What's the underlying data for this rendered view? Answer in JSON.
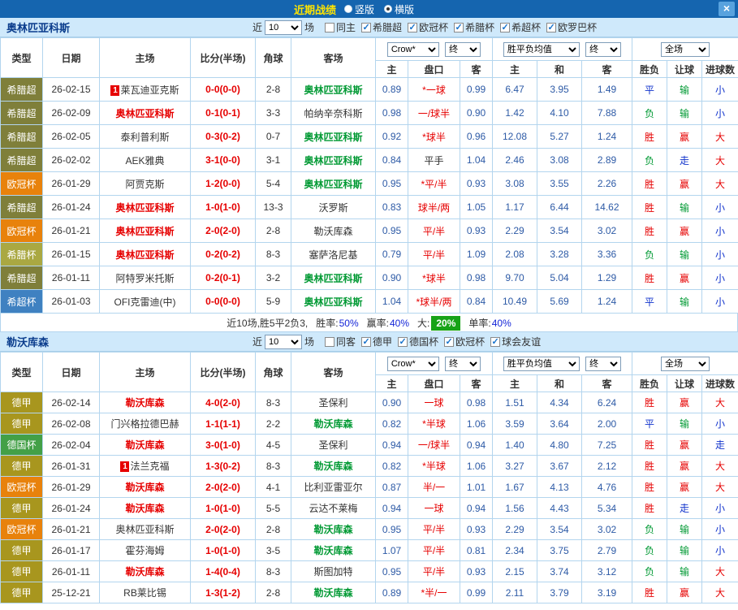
{
  "topbar": {
    "title": "近期战绩",
    "radios": [
      {
        "label": "竖版",
        "selected": false
      },
      {
        "label": "横版",
        "selected": true
      }
    ],
    "close_label": "×"
  },
  "table_header": {
    "cols": [
      "类型",
      "日期",
      "主场",
      "比分(半场)",
      "角球",
      "客场"
    ],
    "sub_cols": [
      "主",
      "盘口",
      "客",
      "主",
      "和",
      "客",
      "胜负",
      "让球",
      "进球数"
    ],
    "odds_source_select": "Crow*",
    "final_label": "终",
    "europe_select": "胜平负均值",
    "scope_select": "全场"
  },
  "sections": [
    {
      "team": "奥林匹亚科斯",
      "near_label": "近",
      "count_value": "10",
      "games_label": "场",
      "checkboxes": [
        {
          "label": "同主",
          "checked": false
        },
        {
          "label": "希腊超",
          "checked": true
        },
        {
          "label": "欧冠杯",
          "checked": true
        },
        {
          "label": "希腊杯",
          "checked": true
        },
        {
          "label": "希超杯",
          "checked": true
        },
        {
          "label": "欧罗巴杯",
          "checked": true
        }
      ],
      "rows": [
        {
          "type": "希腊超",
          "type_color": "#7f7f3a",
          "date": "26-02-15",
          "home": "莱瓦迪亚克斯",
          "home_badge": "1",
          "home_color": "dark",
          "score": "0-0(0-0)",
          "corners": "2-8",
          "away": "奥林匹亚科斯",
          "away_color": "green",
          "asia_home": "0.89",
          "handicap": "*一球",
          "handicap_color": "red",
          "asia_away": "0.99",
          "euro_home": "6.47",
          "euro_draw": "3.95",
          "euro_away": "1.49",
          "result": "平",
          "result_color": "blue",
          "cover": "输",
          "cover_color": "green",
          "goals": "小",
          "goals_color": "blue"
        },
        {
          "type": "希腊超",
          "type_color": "#7f7f3a",
          "date": "26-02-09",
          "home": "奥林匹亚科斯",
          "home_color": "red",
          "score": "0-1(0-1)",
          "corners": "3-3",
          "away": "帕纳辛奈科斯",
          "away_color": "dark",
          "asia_home": "0.98",
          "handicap": "一/球半",
          "handicap_color": "red",
          "asia_away": "0.90",
          "euro_home": "1.42",
          "euro_draw": "4.10",
          "euro_away": "7.88",
          "result": "负",
          "result_color": "green",
          "cover": "输",
          "cover_color": "green",
          "goals": "小",
          "goals_color": "blue"
        },
        {
          "type": "希腊超",
          "type_color": "#7f7f3a",
          "date": "26-02-05",
          "home": "泰利普利斯",
          "home_color": "dark",
          "score": "0-3(0-2)",
          "corners": "0-7",
          "away": "奥林匹亚科斯",
          "away_color": "green",
          "asia_home": "0.92",
          "handicap": "*球半",
          "handicap_color": "red",
          "asia_away": "0.96",
          "euro_home": "12.08",
          "euro_draw": "5.27",
          "euro_away": "1.24",
          "result": "胜",
          "result_color": "red",
          "cover": "赢",
          "cover_color": "red",
          "goals": "大",
          "goals_color": "red"
        },
        {
          "type": "希腊超",
          "type_color": "#7f7f3a",
          "date": "26-02-02",
          "home": "AEK雅典",
          "home_color": "dark",
          "score": "3-1(0-0)",
          "corners": "3-1",
          "away": "奥林匹亚科斯",
          "away_color": "green",
          "asia_home": "0.84",
          "handicap": "平手",
          "handicap_color": "dark",
          "asia_away": "1.04",
          "euro_home": "2.46",
          "euro_draw": "3.08",
          "euro_away": "2.89",
          "result": "负",
          "result_color": "green",
          "cover": "走",
          "cover_color": "blue",
          "goals": "大",
          "goals_color": "red"
        },
        {
          "type": "欧冠杯",
          "type_color": "#e8820c",
          "date": "26-01-29",
          "home": "阿贾克斯",
          "home_color": "dark",
          "score": "1-2(0-0)",
          "corners": "5-4",
          "away": "奥林匹亚科斯",
          "away_color": "green",
          "asia_home": "0.95",
          "handicap": "*平/半",
          "handicap_color": "red",
          "asia_away": "0.93",
          "euro_home": "3.08",
          "euro_draw": "3.55",
          "euro_away": "2.26",
          "result": "胜",
          "result_color": "red",
          "cover": "赢",
          "cover_color": "red",
          "goals": "大",
          "goals_color": "red"
        },
        {
          "type": "希腊超",
          "type_color": "#7f7f3a",
          "date": "26-01-24",
          "home": "奥林匹亚科斯",
          "home_color": "red",
          "score": "1-0(1-0)",
          "corners": "13-3",
          "away": "沃罗斯",
          "away_color": "dark",
          "asia_home": "0.83",
          "handicap": "球半/两",
          "handicap_color": "red",
          "asia_away": "1.05",
          "euro_home": "1.17",
          "euro_draw": "6.44",
          "euro_away": "14.62",
          "result": "胜",
          "result_color": "red",
          "cover": "输",
          "cover_color": "green",
          "goals": "小",
          "goals_color": "blue"
        },
        {
          "type": "欧冠杯",
          "type_color": "#e8820c",
          "date": "26-01-21",
          "home": "奥林匹亚科斯",
          "home_color": "red",
          "score": "2-0(2-0)",
          "corners": "2-8",
          "away": "勒沃库森",
          "away_color": "dark",
          "asia_home": "0.95",
          "handicap": "平/半",
          "handicap_color": "red",
          "asia_away": "0.93",
          "euro_home": "2.29",
          "euro_draw": "3.54",
          "euro_away": "3.02",
          "result": "胜",
          "result_color": "red",
          "cover": "赢",
          "cover_color": "red",
          "goals": "小",
          "goals_color": "blue"
        },
        {
          "type": "希腊杯",
          "type_color": "#aaa842",
          "date": "26-01-15",
          "home": "奥林匹亚科斯",
          "home_color": "red",
          "score": "0-2(0-2)",
          "corners": "8-3",
          "away": "塞萨洛尼基",
          "away_color": "dark",
          "asia_home": "0.79",
          "handicap": "平/半",
          "handicap_color": "red",
          "asia_away": "1.09",
          "euro_home": "2.08",
          "euro_draw": "3.28",
          "euro_away": "3.36",
          "result": "负",
          "result_color": "green",
          "cover": "输",
          "cover_color": "green",
          "goals": "小",
          "goals_color": "blue"
        },
        {
          "type": "希腊超",
          "type_color": "#7f7f3a",
          "date": "26-01-11",
          "home": "阿特罗米托斯",
          "home_color": "dark",
          "score": "0-2(0-1)",
          "corners": "3-2",
          "away": "奥林匹亚科斯",
          "away_color": "green",
          "asia_home": "0.90",
          "handicap": "*球半",
          "handicap_color": "red",
          "asia_away": "0.98",
          "euro_home": "9.70",
          "euro_draw": "5.04",
          "euro_away": "1.29",
          "result": "胜",
          "result_color": "red",
          "cover": "赢",
          "cover_color": "red",
          "goals": "小",
          "goals_color": "blue"
        },
        {
          "type": "希超杯",
          "type_color": "#3f81c1",
          "date": "26-01-03",
          "home": "OFI克雷迪(中)",
          "home_color": "dark",
          "score": "0-0(0-0)",
          "corners": "5-9",
          "away": "奥林匹亚科斯",
          "away_color": "green",
          "asia_home": "1.04",
          "handicap": "*球半/两",
          "handicap_color": "red",
          "asia_away": "0.84",
          "euro_home": "10.49",
          "euro_draw": "5.69",
          "euro_away": "1.24",
          "result": "平",
          "result_color": "blue",
          "cover": "输",
          "cover_color": "green",
          "goals": "小",
          "goals_color": "blue"
        }
      ],
      "summary": {
        "record": "近10场,胜5平2负3,",
        "win_label": "胜率:",
        "win_value": "50%",
        "cover_label": "赢率:",
        "cover_value": "40%",
        "big_label": "大:",
        "big_value": "20%",
        "odd_label": "单率:",
        "odd_value": "40%"
      }
    },
    {
      "team": "勒沃库森",
      "near_label": "近",
      "count_value": "10",
      "games_label": "场",
      "checkboxes": [
        {
          "label": "同客",
          "checked": false
        },
        {
          "label": "德甲",
          "checked": true
        },
        {
          "label": "德国杯",
          "checked": true
        },
        {
          "label": "欧冠杯",
          "checked": true
        },
        {
          "label": "球会友谊",
          "checked": true
        }
      ],
      "rows": [
        {
          "type": "德甲",
          "type_color": "#a8961e",
          "date": "26-02-14",
          "home": "勒沃库森",
          "home_color": "red",
          "score": "4-0(2-0)",
          "corners": "8-3",
          "away": "圣保利",
          "away_color": "dark",
          "asia_home": "0.90",
          "handicap": "一球",
          "handicap_color": "red",
          "asia_away": "0.98",
          "euro_home": "1.51",
          "euro_draw": "4.34",
          "euro_away": "6.24",
          "result": "胜",
          "result_color": "red",
          "cover": "赢",
          "cover_color": "red",
          "goals": "大",
          "goals_color": "red"
        },
        {
          "type": "德甲",
          "type_color": "#a8961e",
          "date": "26-02-08",
          "home": "门兴格拉德巴赫",
          "home_color": "dark",
          "score": "1-1(1-1)",
          "corners": "2-2",
          "away": "勒沃库森",
          "away_color": "green",
          "asia_home": "0.82",
          "handicap": "*半球",
          "handicap_color": "red",
          "asia_away": "1.06",
          "euro_home": "3.59",
          "euro_draw": "3.64",
          "euro_away": "2.00",
          "result": "平",
          "result_color": "blue",
          "cover": "输",
          "cover_color": "green",
          "goals": "小",
          "goals_color": "blue"
        },
        {
          "type": "德国杯",
          "type_color": "#43a047",
          "date": "26-02-04",
          "home": "勒沃库森",
          "home_color": "red",
          "score": "3-0(1-0)",
          "corners": "4-5",
          "away": "圣保利",
          "away_color": "dark",
          "asia_home": "0.94",
          "handicap": "一/球半",
          "handicap_color": "red",
          "asia_away": "0.94",
          "euro_home": "1.40",
          "euro_draw": "4.80",
          "euro_away": "7.25",
          "result": "胜",
          "result_color": "red",
          "cover": "赢",
          "cover_color": "red",
          "goals": "走",
          "goals_color": "blue"
        },
        {
          "type": "德甲",
          "type_color": "#a8961e",
          "date": "26-01-31",
          "home": "法兰克福",
          "home_badge": "1",
          "home_color": "dark",
          "score": "1-3(0-2)",
          "corners": "8-3",
          "away": "勒沃库森",
          "away_color": "green",
          "asia_home": "0.82",
          "handicap": "*半球",
          "handicap_color": "red",
          "asia_away": "1.06",
          "euro_home": "3.27",
          "euro_draw": "3.67",
          "euro_away": "2.12",
          "result": "胜",
          "result_color": "red",
          "cover": "赢",
          "cover_color": "red",
          "goals": "大",
          "goals_color": "red"
        },
        {
          "type": "欧冠杯",
          "type_color": "#e8820c",
          "date": "26-01-29",
          "home": "勒沃库森",
          "home_color": "red",
          "score": "2-0(2-0)",
          "corners": "4-1",
          "away": "比利亚雷亚尔",
          "away_color": "dark",
          "asia_home": "0.87",
          "handicap": "半/一",
          "handicap_color": "red",
          "asia_away": "1.01",
          "euro_home": "1.67",
          "euro_draw": "4.13",
          "euro_away": "4.76",
          "result": "胜",
          "result_color": "red",
          "cover": "赢",
          "cover_color": "red",
          "goals": "大",
          "goals_color": "red"
        },
        {
          "type": "德甲",
          "type_color": "#a8961e",
          "date": "26-01-24",
          "home": "勒沃库森",
          "home_color": "red",
          "score": "1-0(1-0)",
          "corners": "5-5",
          "away": "云达不莱梅",
          "away_color": "dark",
          "asia_home": "0.94",
          "handicap": "一球",
          "handicap_color": "red",
          "asia_away": "0.94",
          "euro_home": "1.56",
          "euro_draw": "4.43",
          "euro_away": "5.34",
          "result": "胜",
          "result_color": "red",
          "cover": "走",
          "cover_color": "blue",
          "goals": "小",
          "goals_color": "blue"
        },
        {
          "type": "欧冠杯",
          "type_color": "#e8820c",
          "date": "26-01-21",
          "home": "奥林匹亚科斯",
          "home_color": "dark",
          "score": "2-0(2-0)",
          "corners": "2-8",
          "away": "勒沃库森",
          "away_color": "green",
          "asia_home": "0.95",
          "handicap": "平/半",
          "handicap_color": "red",
          "asia_away": "0.93",
          "euro_home": "2.29",
          "euro_draw": "3.54",
          "euro_away": "3.02",
          "result": "负",
          "result_color": "green",
          "cover": "输",
          "cover_color": "green",
          "goals": "小",
          "goals_color": "blue"
        },
        {
          "type": "德甲",
          "type_color": "#a8961e",
          "date": "26-01-17",
          "home": "霍芬海姆",
          "home_color": "dark",
          "score": "1-0(1-0)",
          "corners": "3-5",
          "away": "勒沃库森",
          "away_color": "green",
          "asia_home": "1.07",
          "handicap": "平/半",
          "handicap_color": "red",
          "asia_away": "0.81",
          "euro_home": "2.34",
          "euro_draw": "3.75",
          "euro_away": "2.79",
          "result": "负",
          "result_color": "green",
          "cover": "输",
          "cover_color": "green",
          "goals": "小",
          "goals_color": "blue"
        },
        {
          "type": "德甲",
          "type_color": "#a8961e",
          "date": "26-01-11",
          "home": "勒沃库森",
          "home_color": "red",
          "score": "1-4(0-4)",
          "corners": "8-3",
          "away": "斯图加特",
          "away_color": "dark",
          "asia_home": "0.95",
          "handicap": "平/半",
          "handicap_color": "red",
          "asia_away": "0.93",
          "euro_home": "2.15",
          "euro_draw": "3.74",
          "euro_away": "3.12",
          "result": "负",
          "result_color": "green",
          "cover": "输",
          "cover_color": "green",
          "goals": "大",
          "goals_color": "red"
        },
        {
          "type": "德甲",
          "type_color": "#a8961e",
          "date": "25-12-21",
          "home": "RB莱比锡",
          "home_color": "dark",
          "score": "1-3(1-2)",
          "corners": "2-8",
          "away": "勒沃库森",
          "away_color": "green",
          "asia_home": "0.89",
          "handicap": "*半/一",
          "handicap_color": "red",
          "asia_away": "0.99",
          "euro_home": "2.11",
          "euro_draw": "3.79",
          "euro_away": "3.19",
          "result": "胜",
          "result_color": "red",
          "cover": "赢",
          "cover_color": "red",
          "goals": "大",
          "goals_color": "red"
        }
      ]
    }
  ]
}
